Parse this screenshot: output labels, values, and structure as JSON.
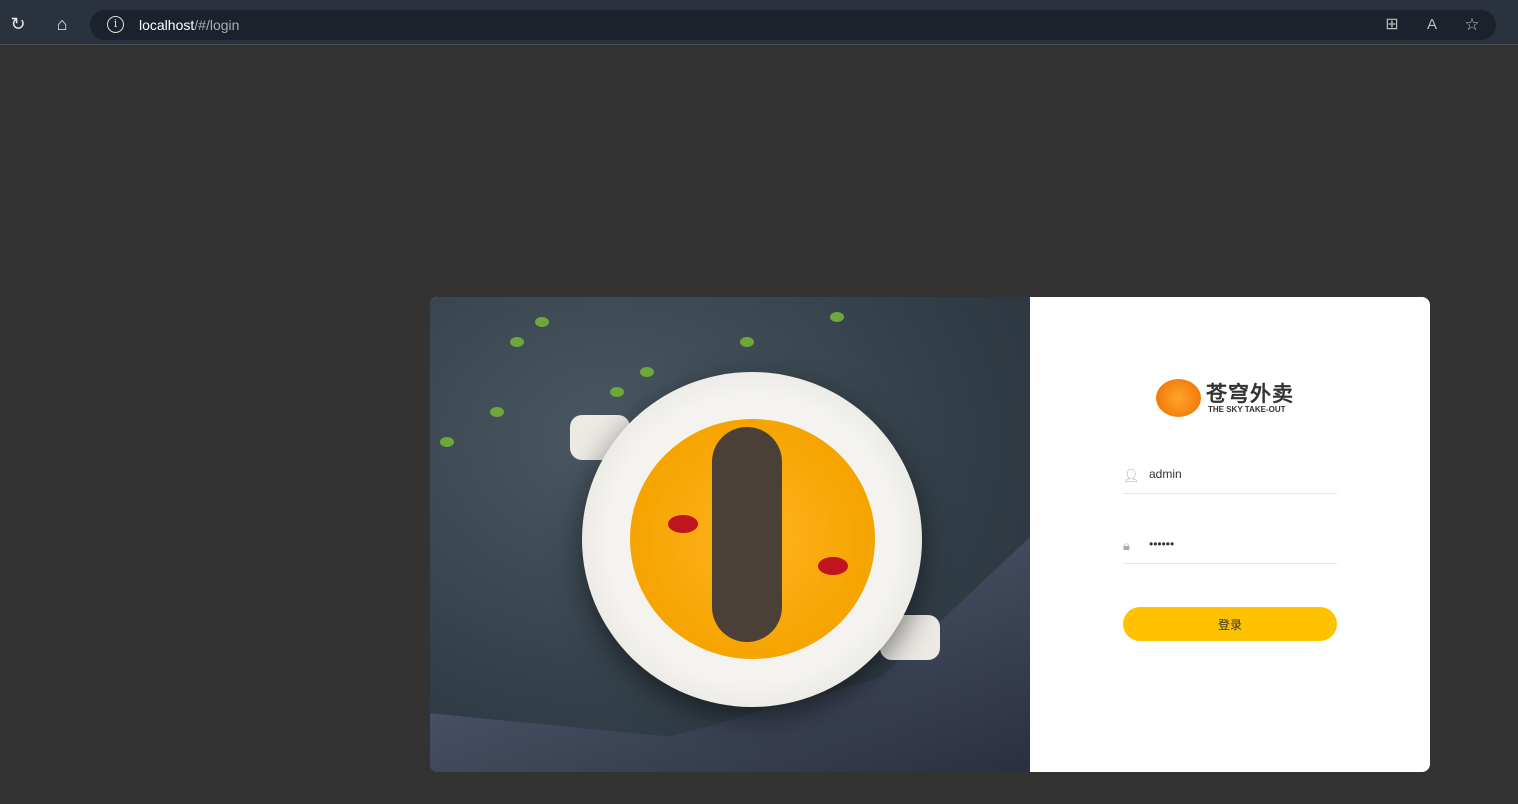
{
  "browser": {
    "url_host": "localhost",
    "url_path": "/#/login",
    "icons": [
      "refresh-icon",
      "home-icon",
      "info-icon",
      "split-screen-icon",
      "read-aloud-icon",
      "favorite-star-icon"
    ]
  },
  "login": {
    "logo": {
      "cn": "苍穹外卖",
      "en": "THE SKY TAKE-OUT"
    },
    "username": {
      "value": "admin",
      "icon": "user-icon"
    },
    "password": {
      "value": "123456",
      "icon": "lock-icon"
    },
    "submit_label": "登录",
    "colors": {
      "button": "#ffc200",
      "background": "#333333"
    }
  }
}
